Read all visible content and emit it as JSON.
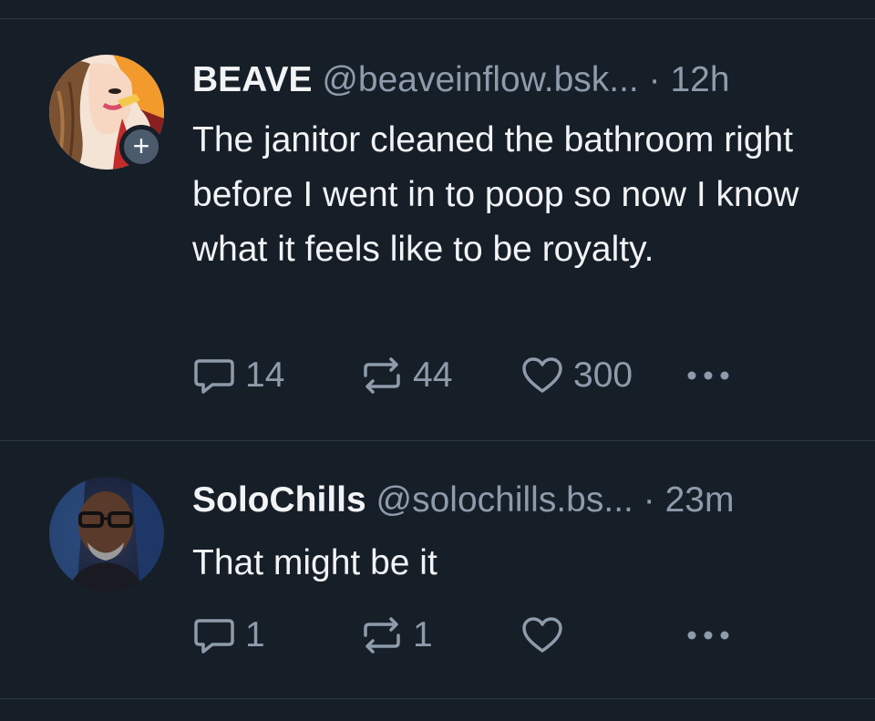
{
  "posts": [
    {
      "author": {
        "name": "BEAVE",
        "handle": "@beaveinflow.bsk...",
        "avatar_icon": "avatar-beave",
        "follow_badge": "+"
      },
      "separator": "·",
      "time": "12h",
      "text": "The janitor cleaned the bathroom right before I went in to poop so now I know what it feels like to be royalty.",
      "actions": {
        "reply_count": "14",
        "repost_count": "44",
        "like_count": "300"
      }
    },
    {
      "author": {
        "name": "SoloChills",
        "handle": "@solochills.bs...",
        "avatar_icon": "avatar-solochills"
      },
      "separator": "·",
      "time": "23m",
      "text": "That might be it",
      "actions": {
        "reply_count": "1",
        "repost_count": "1",
        "like_count": ""
      }
    }
  ],
  "colors": {
    "background": "#161e27",
    "text_primary": "#f1f3f5",
    "text_secondary": "#8d9bab",
    "divider": "#2e3a48"
  }
}
